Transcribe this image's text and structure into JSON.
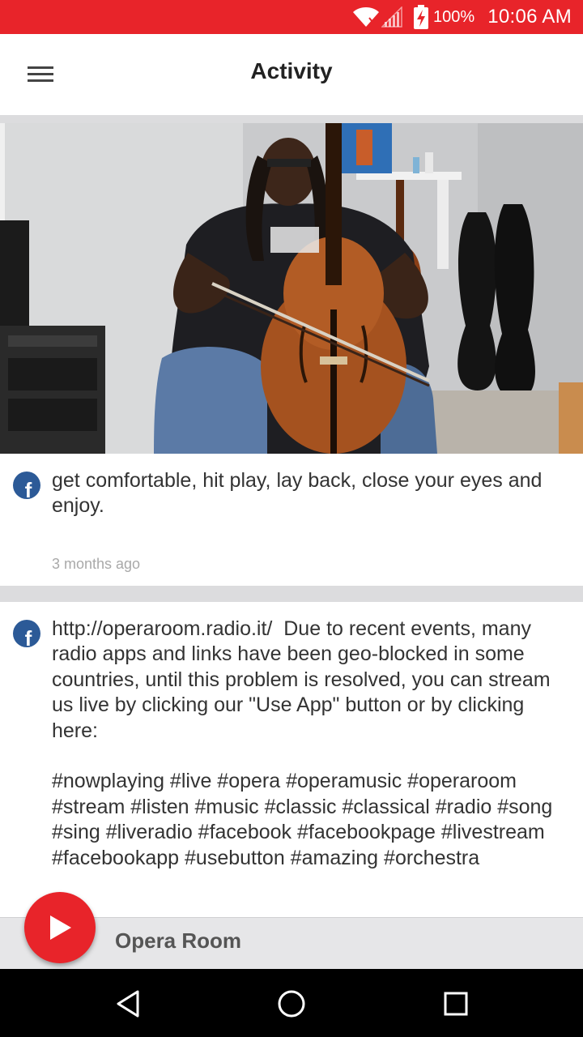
{
  "status_bar": {
    "battery": "100%",
    "time": "10:06 AM",
    "icons": [
      "wifi-icon",
      "cell-signal-icon",
      "battery-charging-icon"
    ],
    "color": "#e8242a"
  },
  "app_bar": {
    "title": "Activity",
    "menu_icon": "hamburger-menu-icon"
  },
  "feed": {
    "posts": [
      {
        "source_icon": "facebook-icon",
        "has_image": true,
        "image_alt": "cellist-photo",
        "text": "get comfortable, hit play, lay back, close your eyes and enjoy.",
        "time": "3 months ago"
      },
      {
        "source_icon": "facebook-icon",
        "has_image": false,
        "text": "http://operaroom.radio.it/  Due to recent events, many radio apps and links have been geo-blocked in some countries, until this problem is resolved, you can stream us live by clicking our \"Use App\" button or by clicking here:\n\n#nowplaying #live #opera #operamusic #operaroom #stream #listen #music #classic #classical #radio #song #sing #liveradio #facebook #facebookpage #livestream #facebookapp #usebutton #amazing #orchestra"
      }
    ]
  },
  "player": {
    "station_name": "Opera Room",
    "play_icon": "play-icon",
    "accent_color": "#e8242a"
  },
  "nav_bar": {
    "buttons": [
      "back-icon",
      "home-icon",
      "recents-icon"
    ]
  }
}
